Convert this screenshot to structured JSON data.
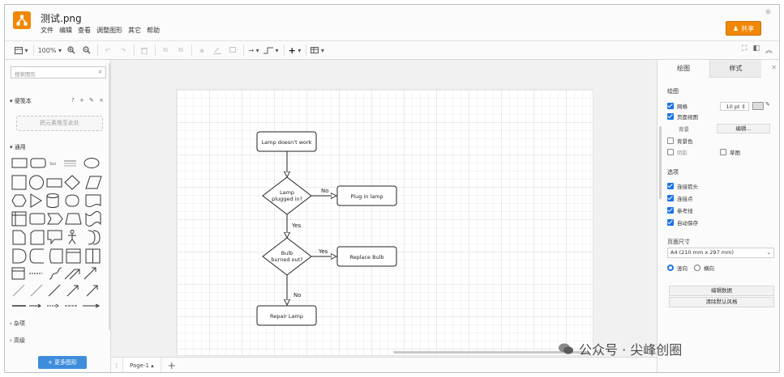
{
  "header": {
    "file_title": "测试.png",
    "menu": [
      "文件",
      "编辑",
      "查看",
      "调整图形",
      "其它",
      "帮助"
    ],
    "share_label": "共享"
  },
  "toolbar": {
    "zoom": "100%"
  },
  "left_panel": {
    "search_placeholder": "搜索图形",
    "scratchpad_title": "便笺本",
    "scratchpad_icons": "? + ✎ ×",
    "drop_hint": "把元素拖至此处",
    "general_title": "通用",
    "misc_title": "杂项",
    "advanced_title": "高级",
    "more_shapes": "+ 更多图形"
  },
  "diagram": {
    "nodes": {
      "start": "Lamp doesn't work",
      "q1_line1": "Lamp",
      "q1_line2": "plugged in?",
      "plug": "Plug in lamp",
      "q2_line1": "Bulb",
      "q2_line2": "burned out?",
      "replace": "Replace Bulb",
      "repair": "Repair Lamp"
    },
    "edges": {
      "no1": "No",
      "yes1": "Yes",
      "yes2": "Yes",
      "no2": "No"
    }
  },
  "pagebar": {
    "tab_label": "Page-1"
  },
  "right_panel": {
    "tab_diagram": "绘图",
    "tab_style": "样式",
    "section_drawing": "绘图",
    "grid_label": "网格",
    "grid_size": "10 pt",
    "page_view_label": "页面视图",
    "background_label": "背景",
    "edit_label": "编辑...",
    "bg_color_label": "背景色",
    "shadow_label": "阴影",
    "sketch_label": "草图",
    "section_options": "选项",
    "connection_arrows": "连接箭头",
    "connection_points": "连接点",
    "guides": "参考线",
    "autosave": "自动保存",
    "section_paper": "页面尺寸",
    "paper_size": "A4 (210 mm x 297 mm)",
    "portrait": "竖向",
    "landscape": "横向",
    "edit_data": "编辑数据",
    "clear_style": "清除默认风格"
  },
  "watermark": {
    "text": "公众号 · 尖峰创圈"
  }
}
